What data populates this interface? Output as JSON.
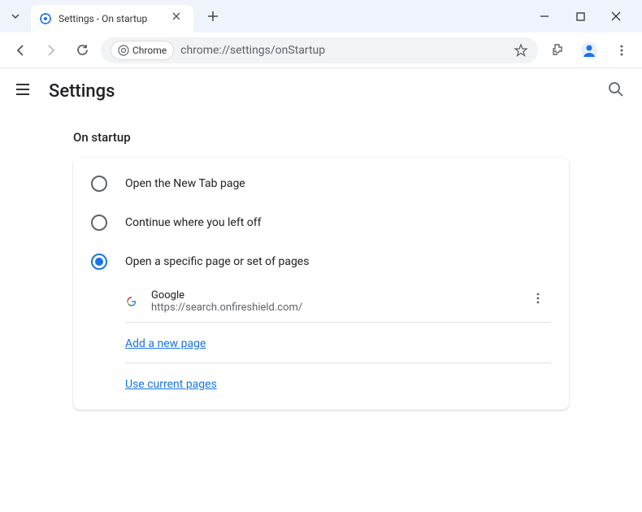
{
  "window": {
    "tab_title": "Settings - On startup"
  },
  "toolbar": {
    "chrome_chip": "Chrome",
    "url": "chrome://settings/onStartup"
  },
  "header": {
    "title": "Settings"
  },
  "section": {
    "title": "On startup"
  },
  "options": [
    {
      "label": "Open the New Tab page",
      "selected": false
    },
    {
      "label": "Continue where you left off",
      "selected": false
    },
    {
      "label": "Open a specific page or set of pages",
      "selected": true
    }
  ],
  "pages": [
    {
      "name": "Google",
      "url": "https://search.onfireshield.com/"
    }
  ],
  "actions": {
    "add_page": "Add a new page",
    "use_current": "Use current pages"
  }
}
